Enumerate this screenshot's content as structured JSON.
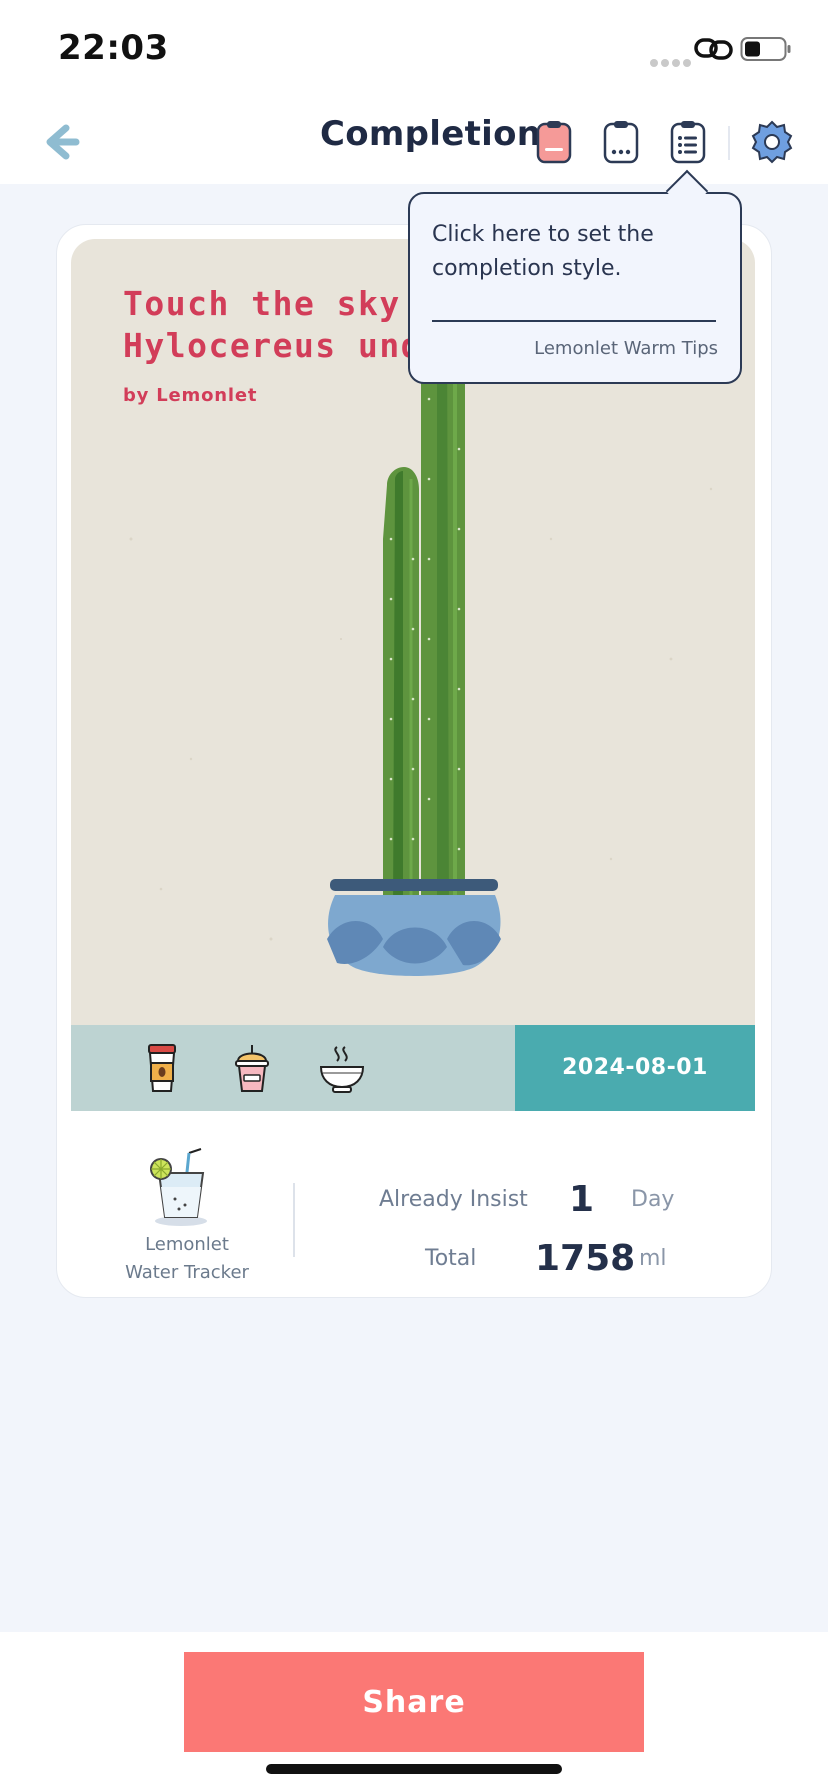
{
  "status_bar": {
    "time": "22:03",
    "icons": [
      "signal-dots-icon",
      "link-icon",
      "battery-icon"
    ]
  },
  "nav": {
    "title": "Completion",
    "icons": [
      "back-arrow-icon",
      "clipboard-red-icon",
      "clipboard-dots-icon",
      "clipboard-list-icon",
      "gear-icon"
    ]
  },
  "tooltip": {
    "text": "Click here to set the completion style.",
    "footer": "Lemonlet Warm Tips"
  },
  "poster": {
    "title": "Touch the sky li\nHylocereus unda",
    "byline": "by Lemonlet",
    "drink_icons": [
      "coffee-cup-icon",
      "bubble-tea-icon",
      "hot-soup-bowl-icon"
    ],
    "date": "2024-08-01"
  },
  "brand": {
    "line1": "Lemonlet",
    "line2": "Water Tracker"
  },
  "stats": {
    "insist_label": "Already Insist",
    "insist_value": "1",
    "insist_unit": "Day",
    "total_label": "Total",
    "total_value": "1758",
    "total_unit": "ml"
  },
  "share_button": "Share",
  "colors": {
    "accent": "#fb7875",
    "teal": "#4aabaf",
    "title_red": "#d23d59",
    "pot_blue": "#7ea8cf"
  }
}
